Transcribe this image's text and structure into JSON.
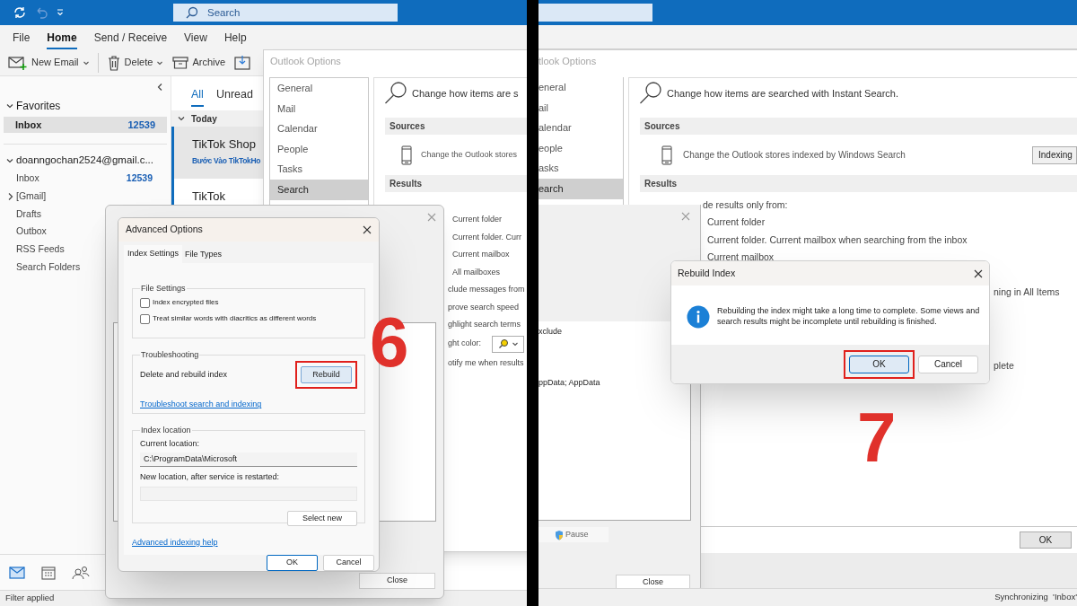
{
  "left_screenshot": {
    "step_number": "6",
    "title_bar": {
      "search_placeholder": "Search"
    },
    "menu_tabs": [
      {
        "label": "File",
        "selected": false
      },
      {
        "label": "Home",
        "selected": true
      },
      {
        "label": "Send / Receive",
        "selected": false
      },
      {
        "label": "View",
        "selected": false
      },
      {
        "label": "Help",
        "selected": false
      }
    ],
    "toolbar": [
      {
        "kind": "new-email",
        "label": "New Email",
        "dropdown": true
      },
      {
        "kind": "delete",
        "label": "Delete",
        "dropdown": true
      },
      {
        "kind": "archive",
        "label": "Archive",
        "dropdown": false
      },
      {
        "kind": "move"
      }
    ],
    "folder_pane": {
      "favorites_label": "Favorites",
      "favorites": [
        {
          "label": "Inbox",
          "count": "12539",
          "selected": true
        }
      ],
      "account": "doanngochan2524@gmail.c...",
      "folders": [
        {
          "label": "Inbox",
          "count": "12539",
          "expandable": false
        },
        {
          "label": "[Gmail]",
          "expandable": true
        },
        {
          "label": "Drafts",
          "expandable": false
        },
        {
          "label": "Outbox",
          "expandable": false
        },
        {
          "label": "RSS Feeds",
          "expandable": false
        },
        {
          "label": "Search Folders",
          "expandable": false
        }
      ]
    },
    "message_list": {
      "filters": [
        {
          "label": "All",
          "selected": true
        },
        {
          "label": "Unread",
          "selected": false
        }
      ],
      "group": "Today",
      "messages": [
        {
          "sender": "TikTok Shop",
          "subject": "Bước Vào TikTokHo",
          "selected": true,
          "unread": true
        },
        {
          "sender": "TikTok",
          "selected": false,
          "unread": true
        }
      ]
    },
    "status_bar": "Filter applied",
    "outlook_options": {
      "title": "Outlook Options",
      "nav": [
        {
          "label": "General",
          "selected": false
        },
        {
          "label": "Mail",
          "selected": false
        },
        {
          "label": "Calendar",
          "selected": false
        },
        {
          "label": "People",
          "selected": false
        },
        {
          "label": "Tasks",
          "selected": false
        },
        {
          "label": "Search",
          "selected": true
        }
      ],
      "heading": "Change how items are s",
      "sources_header": "Sources",
      "sources_text": "Change the Outlook stores",
      "results_header": "Results",
      "results": [
        {
          "kind": "option",
          "label": "Current folder"
        },
        {
          "kind": "option",
          "label": "Current folder. Curr"
        },
        {
          "kind": "option",
          "label": "Current mailbox"
        },
        {
          "kind": "option",
          "label": "All mailboxes"
        },
        {
          "kind": "line",
          "label": "clude messages from"
        },
        {
          "kind": "line",
          "label": "prove search speed"
        },
        {
          "kind": "line",
          "label": "ghlight search terms"
        },
        {
          "kind": "color",
          "label": "ght color:"
        },
        {
          "kind": "line",
          "label": "otify me when results"
        }
      ]
    },
    "indexing_options": {
      "close_button": "Close"
    },
    "advanced_options": {
      "title": "Advanced Options",
      "tabs": [
        {
          "label": "Index Settings",
          "selected": true
        },
        {
          "label": "File Types",
          "selected": false
        }
      ],
      "file_settings": {
        "label": "File Settings",
        "checkboxes": [
          {
            "label": "Index encrypted files",
            "checked": false
          },
          {
            "label": "Treat similar words with diacritics as different words",
            "checked": false
          }
        ]
      },
      "troubleshooting": {
        "label": "Troubleshooting",
        "text": "Delete and rebuild index",
        "button": {
          "label": "Rebuild",
          "highlighted": true
        },
        "link": "Troubleshoot search and indexing"
      },
      "index_location": {
        "label": "Index location",
        "current_label": "Current location:",
        "current_value": "C:\\ProgramData\\Microsoft",
        "new_label": "New location, after service is restarted:",
        "button": "Select new"
      },
      "help_link": "Advanced indexing help",
      "buttons": [
        {
          "label": "OK",
          "default": true
        },
        {
          "label": "Cancel",
          "default": false
        }
      ]
    }
  },
  "right_screenshot": {
    "step_number": "7",
    "outlook_options": {
      "title": "tlook Options",
      "nav": [
        {
          "label": "eneral",
          "selected": false
        },
        {
          "label": "ail",
          "selected": false
        },
        {
          "label": "alendar",
          "selected": false
        },
        {
          "label": "eople",
          "selected": false
        },
        {
          "label": "asks",
          "selected": false
        },
        {
          "label": "earch",
          "selected": true
        }
      ],
      "heading": "Change how items are searched with Instant Search.",
      "sources_header": "Sources",
      "sources_text": "Change the Outlook stores indexed by Windows Search",
      "indexing_button": "Indexing",
      "results_header": "Results",
      "results": [
        {
          "kind": "line",
          "label": "de results only from:"
        },
        {
          "kind": "option",
          "label": "Current folder"
        },
        {
          "kind": "option",
          "label": "Current folder. Current mailbox when searching from the inbox"
        },
        {
          "kind": "option",
          "label": "Current mailbox"
        }
      ],
      "covered_texts": [
        "ning in All Items",
        "plete"
      ],
      "ok_button": "OK"
    },
    "indexing_options": {
      "texts": [
        "xclude",
        "ppData; AppData"
      ],
      "pause_button": "Pause",
      "close_button": "Close"
    },
    "rebuild_dialog": {
      "title": "Rebuild Index",
      "message": "Rebuilding the index might take a long time to complete. Some views and search results might be incomplete until rebuilding is finished.",
      "buttons": [
        {
          "label": "OK",
          "highlighted": true,
          "default": true
        },
        {
          "label": "Cancel",
          "highlighted": false,
          "default": false
        }
      ]
    },
    "status_bar": "Synchronizing  'Inbox'"
  }
}
